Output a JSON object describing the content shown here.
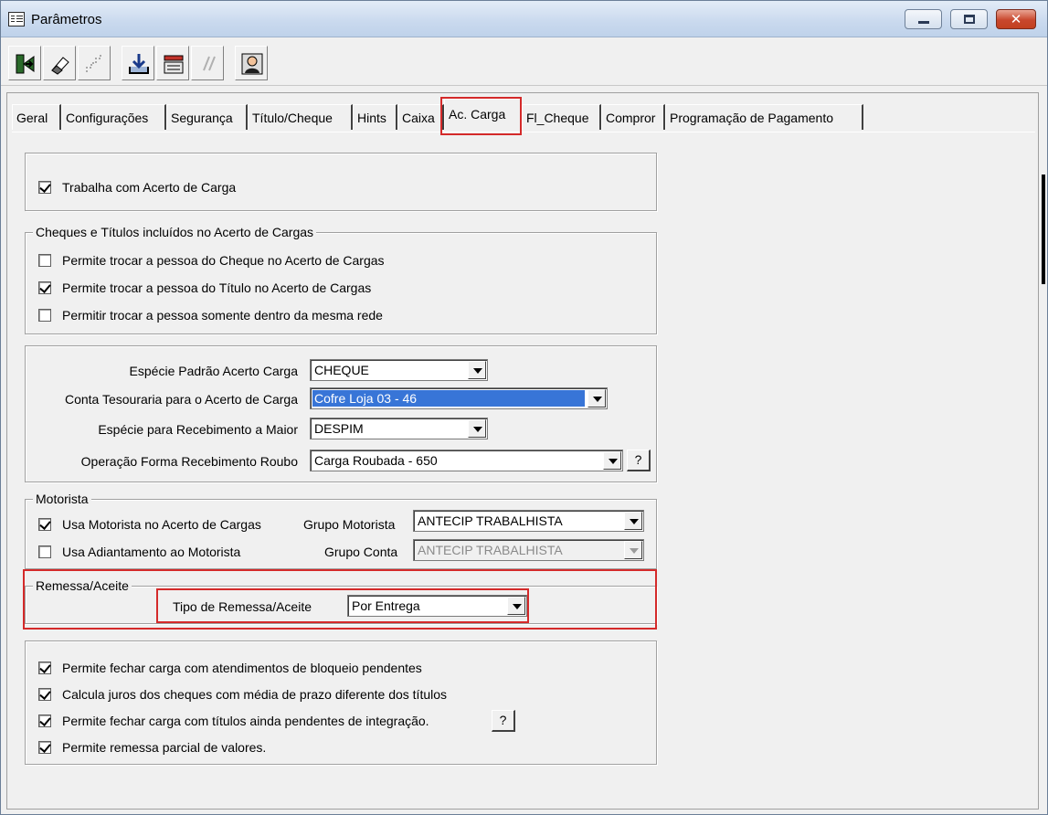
{
  "window": {
    "title": "Parâmetros"
  },
  "toolbar": {
    "buttons": [
      {
        "name": "exit-button",
        "icon": "exit-door-icon",
        "enabled": true
      },
      {
        "name": "edit-button",
        "icon": "eraser-icon",
        "enabled": true
      },
      {
        "name": "undo-button",
        "icon": "stairs-icon",
        "enabled": false
      },
      {
        "name": "save-button",
        "icon": "download-tray-icon",
        "enabled": true
      },
      {
        "name": "load-button",
        "icon": "open-folder-icon",
        "enabled": true
      },
      {
        "name": "cut-button",
        "icon": "scissors-icon",
        "enabled": false
      },
      {
        "name": "user-button",
        "icon": "user-icon",
        "enabled": true
      }
    ]
  },
  "tabs": [
    {
      "label": "Geral"
    },
    {
      "label": "Configurações"
    },
    {
      "label": "Segurança"
    },
    {
      "label": "Título/Cheque"
    },
    {
      "label": "Hints"
    },
    {
      "label": "Caixa"
    },
    {
      "label": "Ac. Carga",
      "active": true
    },
    {
      "label": "Fl_Cheque"
    },
    {
      "label": "Compror"
    },
    {
      "label": "Programação de Pagamento"
    }
  ],
  "section_main": {
    "trabalha_acerto": {
      "label": "Trabalha com Acerto de Carga",
      "checked": true
    }
  },
  "section_cheques": {
    "legend": "Cheques e Títulos incluídos no Acerto de Cargas",
    "items": [
      {
        "label": "Permite trocar a pessoa do Cheque no Acerto de Cargas",
        "checked": false
      },
      {
        "label": "Permite trocar a pessoa do Título no Acerto de Cargas",
        "checked": true
      },
      {
        "label": "Permitir trocar a pessoa somente dentro da mesma rede",
        "checked": false
      }
    ]
  },
  "section_especie": {
    "especie_padrao": {
      "label": "Espécie Padrão Acerto Carga",
      "value": "CHEQUE"
    },
    "conta_tesouraria": {
      "label": "Conta Tesouraria para o Acerto de Carga",
      "value": "Cofre Loja 03 - 46"
    },
    "especie_recebimento": {
      "label": "Espécie para Recebimento a Maior",
      "value": "DESPIM"
    },
    "operacao_roubo": {
      "label": "Operação Forma Recebimento Roubo",
      "value": "Carga Roubada - 650",
      "help": "?"
    }
  },
  "section_motorista": {
    "legend": "Motorista",
    "usa_motorista": {
      "label": "Usa Motorista no Acerto de Cargas",
      "checked": true
    },
    "grupo_motorista": {
      "label": "Grupo Motorista",
      "value": "ANTECIP TRABALHISTA"
    },
    "usa_adiantamento": {
      "label": "Usa Adiantamento ao Motorista",
      "checked": false
    },
    "grupo_conta": {
      "label": "Grupo Conta",
      "value": "ANTECIP TRABALHISTA"
    }
  },
  "section_remessa": {
    "legend": "Remessa/Aceite",
    "tipo": {
      "label": "Tipo de Remessa/Aceite",
      "value": "Por Entrega"
    }
  },
  "section_final": {
    "items": [
      {
        "label": "Permite fechar carga com atendimentos de bloqueio pendentes",
        "checked": true
      },
      {
        "label": "Calcula juros dos cheques com média de prazo diferente dos títulos",
        "checked": true
      },
      {
        "label": "Permite fechar carga com títulos ainda pendentes de integração.",
        "checked": true
      },
      {
        "label": "Permite remessa parcial de valores.",
        "checked": true
      }
    ],
    "help": "?"
  },
  "colors": {
    "highlight": "#d42a2a",
    "selection": "#3875d7",
    "window_bg": "#f0f0f0"
  }
}
